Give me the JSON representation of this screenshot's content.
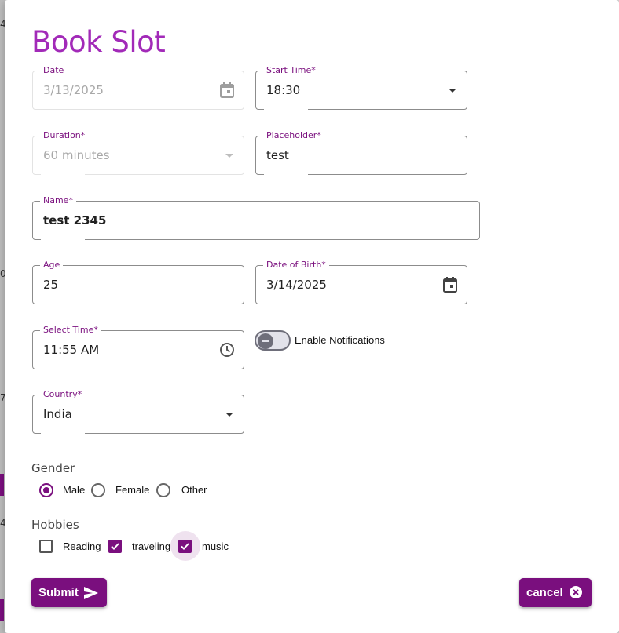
{
  "dialog": {
    "title": "Book Slot"
  },
  "background": {
    "glyphs": [
      "4",
      "0",
      "7",
      "4",
      "4"
    ]
  },
  "fields": {
    "date": {
      "label": "Date",
      "value": "3/13/2025",
      "icon": "calendar-icon",
      "disabled": true
    },
    "start_time": {
      "label": "Start Time*",
      "value": "18:30",
      "icon": "dropdown-caret-icon"
    },
    "duration": {
      "label": "Duration*",
      "value": "60 minutes",
      "icon": "dropdown-caret-icon",
      "disabled": true
    },
    "placeholder": {
      "label": "Placeholder*",
      "value": "test"
    },
    "name": {
      "label": "Name*",
      "value": "test 2345"
    },
    "age": {
      "label": "Age",
      "value": "25"
    },
    "date_of_birth": {
      "label": "Date of Birth*",
      "value": "3/14/2025",
      "icon": "calendar-icon"
    },
    "select_time": {
      "label": "Select Time*",
      "value": "11:55 AM",
      "icon": "clock-icon"
    },
    "country": {
      "label": "Country*",
      "value": "India",
      "icon": "dropdown-caret-icon"
    }
  },
  "notifications": {
    "label": "Enable Notifications",
    "enabled": false
  },
  "gender": {
    "label": "Gender",
    "options": [
      "Male",
      "Female",
      "Other"
    ],
    "selected": "Male"
  },
  "hobbies": {
    "label": "Hobbies",
    "options": [
      {
        "label": "Reading",
        "checked": false
      },
      {
        "label": "traveling",
        "checked": true
      },
      {
        "label": "music",
        "checked": true
      }
    ]
  },
  "actions": {
    "submit_label": "Submit",
    "submit_icon": "send-icon",
    "cancel_label": "cancel",
    "cancel_icon": "close-circle-icon"
  },
  "colors": {
    "accent": "#7a0f7e",
    "title": "#a22ab8",
    "disabled_text": "#a8a8a8"
  }
}
